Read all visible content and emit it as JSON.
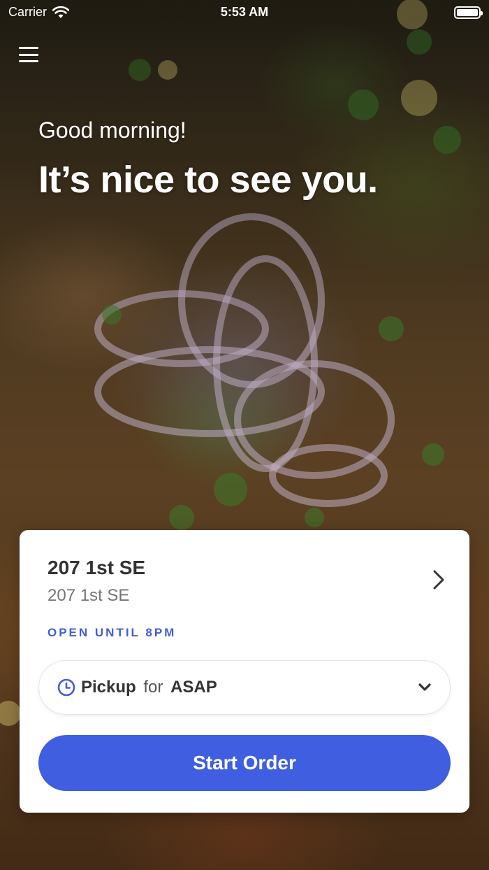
{
  "status_bar": {
    "carrier": "Carrier",
    "time": "5:53 AM"
  },
  "header": {
    "greeting": "Good morning!",
    "headline": "It’s nice to see you."
  },
  "location_card": {
    "name": "207 1st SE",
    "address": "207 1st SE",
    "hours": "OPEN UNTIL 8PM",
    "order_mode": "Pickup",
    "order_for": "for",
    "order_time": "ASAP",
    "start_button_label": "Start Order"
  },
  "icons": {
    "menu": "hamburger-menu-icon",
    "wifi": "wifi-icon",
    "battery": "battery-icon",
    "chevron_right": "chevron-right-icon",
    "clock": "clock-icon",
    "chevron_down": "chevron-down-icon"
  },
  "colors": {
    "accent": "#3f5fe0",
    "hours_text": "#3f5fd8",
    "card_bg": "#ffffff",
    "primary_text": "#333333",
    "secondary_text": "#757575"
  }
}
